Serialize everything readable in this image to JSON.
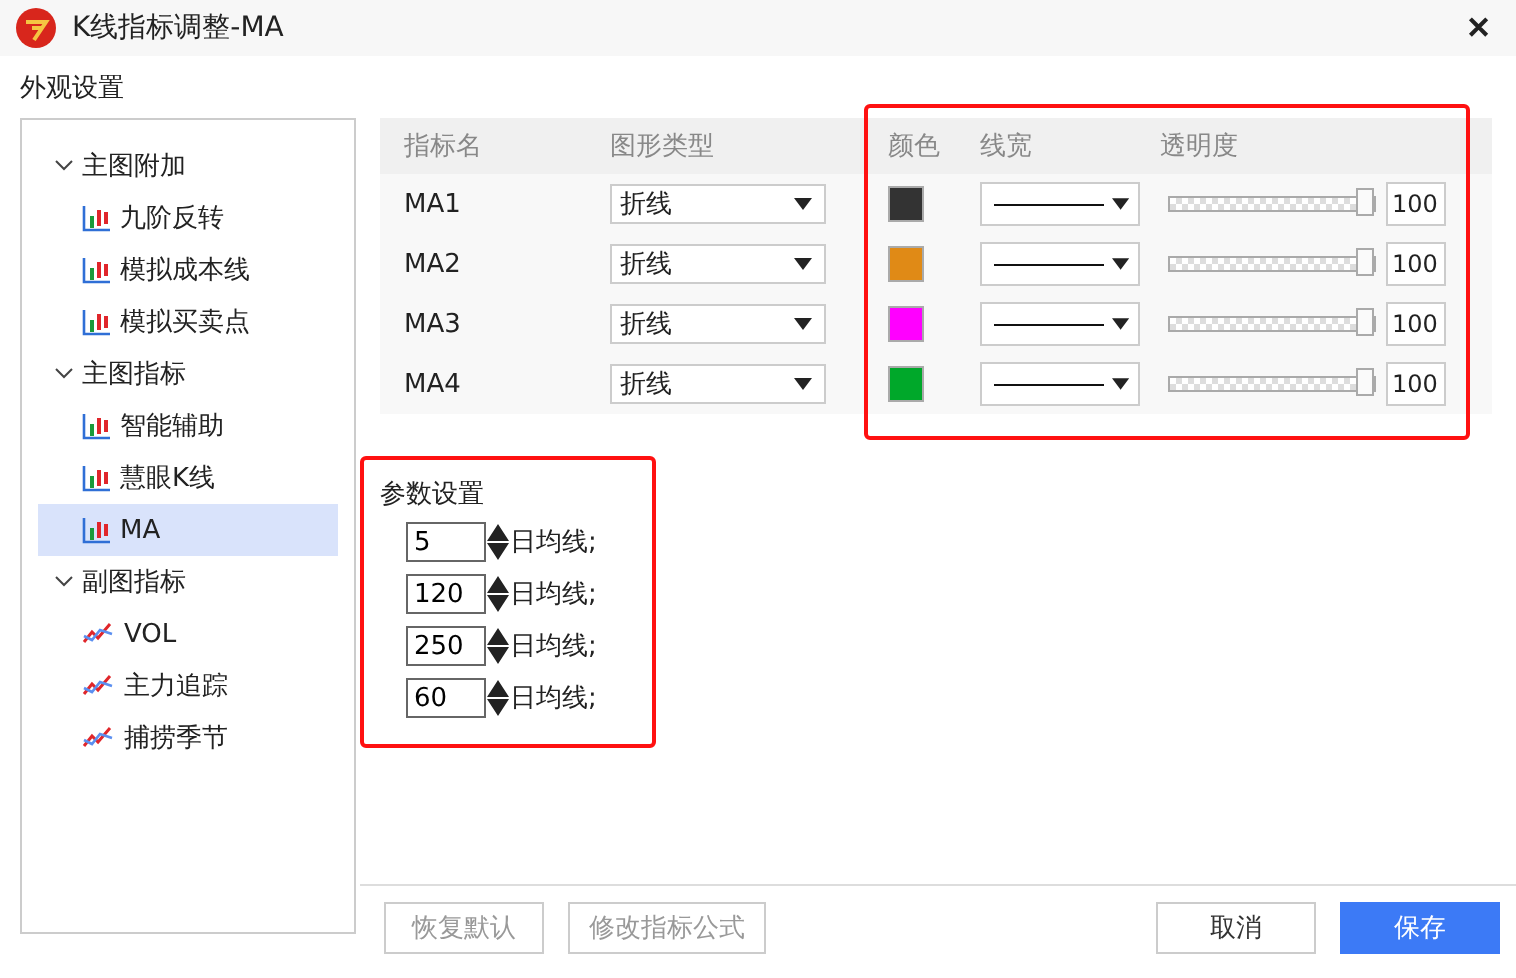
{
  "window": {
    "title": "K线指标调整-MA",
    "close": "✕"
  },
  "section_label": "外观设置",
  "tree": [
    {
      "label": "主图附加",
      "expanded": true,
      "children": [
        {
          "label": "九阶反转",
          "kind": "candle",
          "selected": false
        },
        {
          "label": "模拟成本线",
          "kind": "candle",
          "selected": false
        },
        {
          "label": "模拟买卖点",
          "kind": "candle",
          "selected": false
        }
      ]
    },
    {
      "label": "主图指标",
      "expanded": true,
      "children": [
        {
          "label": "智能辅助",
          "kind": "candle",
          "selected": false
        },
        {
          "label": "慧眼K线",
          "kind": "candle",
          "selected": false
        },
        {
          "label": "MA",
          "kind": "candle",
          "selected": true
        }
      ]
    },
    {
      "label": "副图指标",
      "expanded": true,
      "children": [
        {
          "label": "VOL",
          "kind": "line",
          "selected": false
        },
        {
          "label": "主力追踪",
          "kind": "line",
          "selected": false
        },
        {
          "label": "捕捞季节",
          "kind": "line",
          "selected": false
        }
      ]
    }
  ],
  "table": {
    "columns": [
      "指标名",
      "图形类型",
      "颜色",
      "线宽",
      "透明度"
    ],
    "highlighted": true,
    "rows": [
      {
        "name": "MA1",
        "type": "折线",
        "color": "#333333",
        "level": 1,
        "opacity": "100"
      },
      {
        "name": "MA2",
        "type": "折线",
        "color": "#e08a16",
        "level": 1,
        "opacity": "100"
      },
      {
        "name": "MA3",
        "type": "折线",
        "color": "#ff00ff",
        "level": 1,
        "opacity": "100"
      },
      {
        "name": "MA4",
        "type": "折线",
        "color": "#00a82a",
        "level": 1,
        "opacity": "100"
      }
    ]
  },
  "params": {
    "title": "参数设置",
    "highlighted": true,
    "rows": [
      {
        "value": "5",
        "label": "日均线;"
      },
      {
        "value": "120",
        "label": "日均线;"
      },
      {
        "value": "250",
        "label": "日均线;"
      },
      {
        "value": "60",
        "label": "日均线;"
      }
    ]
  },
  "buttons": [
    {
      "label": "恢复默认",
      "kind": "plain",
      "disabled": true
    },
    {
      "label": "修改指标公式",
      "kind": "plain",
      "disabled": true
    },
    {
      "label": "取消",
      "kind": "plain",
      "disabled": false
    },
    {
      "label": "保存",
      "kind": "primary",
      "disabled": false
    }
  ]
}
